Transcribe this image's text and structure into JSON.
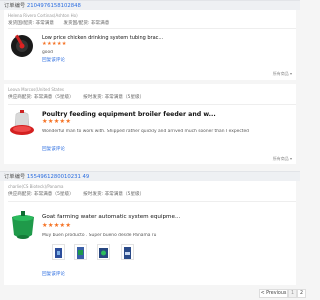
{
  "orders": [
    {
      "order_label": "订单编号",
      "order_id": "2104976158102848",
      "buyer": "Helena Rivero Cortinas(Ashton Ho)",
      "shipped_label": "发货国/配货",
      "shipped_value": "非常满意",
      "fulfill_label": "发货国/配货",
      "fulfill_value": "非常满意",
      "product_title": "Low price chicken drinking system tubing brac...",
      "stars": "★★★★★",
      "review": "good",
      "reply": "回复该评论",
      "more": "所有商品"
    },
    {
      "order_label": "",
      "order_id": "",
      "buyer": "Leova Marcos(United States",
      "shipped_label": "供应商配货",
      "shipped_value": "非常满意（5星级）",
      "fulfill_label": "按时发货",
      "fulfill_value": "非常满意（5星级）",
      "product_title": "Poultry feeding equipment broiler feeder and w...",
      "stars": "★★★★★",
      "review": "Wonderful man to work with. Shipped rather quickly and arrived much sooner than I expected",
      "reply": "回复该评论",
      "more": "所有商品"
    },
    {
      "order_label": "订单编号",
      "order_id": "1554961280010231 49",
      "buyer": "charlie(CS Bioteck)/Panama",
      "shipped_label": "供应商配货",
      "shipped_value": "非常满意（5星级）",
      "fulfill_label": "按时发货",
      "fulfill_value": "非常满意（5星级）",
      "product_title": "Goat farming water automatic system equipme...",
      "stars": "★★★★★",
      "review": "Muy buen producto . Super bueno desde Panama ru",
      "reply": "回复该评论",
      "more": ""
    }
  ],
  "pagination": {
    "previous": "< Previous",
    "page_1": "1",
    "page_2": "2"
  },
  "colors": {
    "accent": "#2b6de0",
    "stars": "#f57224",
    "page_bg": "#f5f5f5"
  },
  "icons": [
    "chicken-drinker-thumbnail",
    "poultry-feeder-thumbnail",
    "goat-water-bowl-thumbnail"
  ]
}
